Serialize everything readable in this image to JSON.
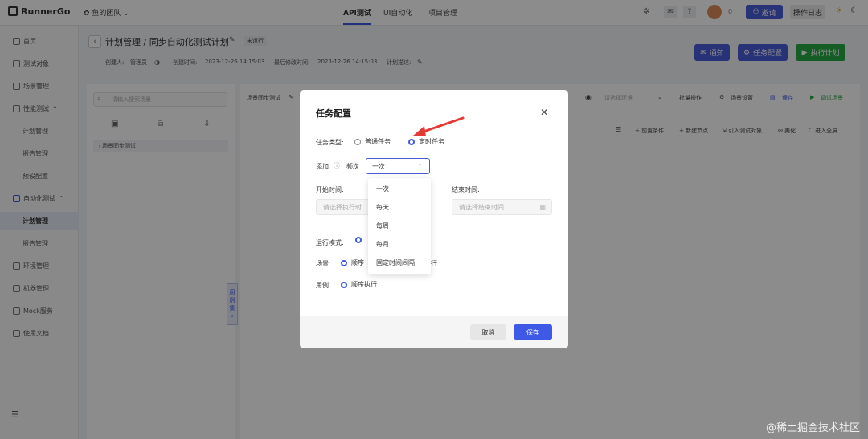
{
  "app": {
    "logo_text": "RunnerGo",
    "team": "鱼的团队"
  },
  "topnav": {
    "tabs": [
      "API测试",
      "UI自动化",
      "项目管理"
    ],
    "active_tab": "API测试",
    "count": "0",
    "invite_label": "邀请",
    "log_label": "操作日志"
  },
  "sidebar": {
    "items": [
      {
        "label": "首页"
      },
      {
        "label": "测试对象"
      },
      {
        "label": "场景管理"
      },
      {
        "label": "性能测试"
      },
      {
        "label": "计划管理"
      },
      {
        "label": "报告管理"
      },
      {
        "label": "预设配置"
      },
      {
        "label": "自动化测试"
      },
      {
        "label": "计划管理"
      },
      {
        "label": "报告管理"
      },
      {
        "label": "环境管理"
      },
      {
        "label": "机器管理"
      },
      {
        "label": "Mock服务"
      },
      {
        "label": "使用文档"
      }
    ],
    "collapse_icon": "menu-icon"
  },
  "header": {
    "breadcrumb": "计划管理 / 同步自动化测试计划",
    "status_badge": "未运行",
    "creator_label": "创建人:",
    "creator": "管理员",
    "created_label": "创建时间:",
    "created": "2023-12-26 14:15:03",
    "modified_label": "最后修改时间:",
    "modified": "2023-12-26 14:15:03",
    "desc_label": "计划描述:",
    "notify_label": "通知",
    "task_config_label": "任务配置",
    "run_label": "执行计划"
  },
  "left_panel": {
    "search_placeholder": "请输入搜索场景",
    "scene_item": "场景同步测试"
  },
  "toolbar": {
    "scene_name": "场景同步测试",
    "env_placeholder": "请选择环境",
    "batch_label": "批量操作",
    "scene_settings_label": "场景设置",
    "save_label": "保存",
    "debug_label": "调试场景",
    "tools": [
      "前置条件",
      "新建节点",
      "引入测试对象",
      "美化",
      "进入全屏"
    ]
  },
  "side_tab": {
    "chars": [
      "用",
      "例",
      "集",
      "›"
    ]
  },
  "modal": {
    "title": "任务配置",
    "task_type_label": "任务类型:",
    "type_normal": "普通任务",
    "type_timed": "定时任务",
    "add_label": "添加",
    "freq_label": "频次",
    "freq_value": "一次",
    "freq_options": [
      "一次",
      "每天",
      "每周",
      "每月",
      "固定时间间隔"
    ],
    "start_label": "开始时间:",
    "start_placeholder": "请选择执行时",
    "end_label": "结束时间:",
    "end_placeholder": "请选择结束时间",
    "run_mode_label": "运行模式:",
    "scene_label": "场景:",
    "scene_value": "顺序",
    "scene_truncated": "行",
    "case_label": "用例:",
    "case_value": "顺序执行",
    "cancel_label": "取消",
    "save_label": "保存"
  },
  "watermark": "@稀土掘金技术社区",
  "colors": {
    "primary": "#3d59e6",
    "run_green": "#27a844",
    "arrow_red": "#e53935"
  }
}
